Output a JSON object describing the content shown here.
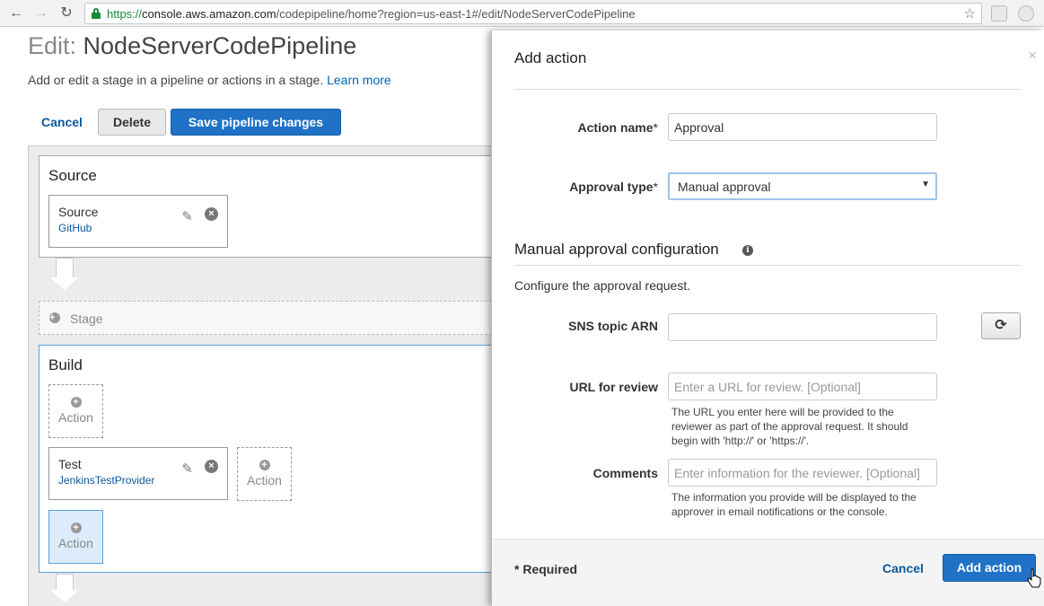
{
  "browser": {
    "url_proto": "https://",
    "url_host": "console.aws.amazon.com",
    "url_path": "/codepipeline/home?region=us-east-1#/edit/NodeServerCodePipeline"
  },
  "header": {
    "title_prefix": "Edit:",
    "title_name": "NodeServerCodePipeline",
    "description": "Add or edit a stage in a pipeline or actions in a stage.",
    "learn_more": "Learn more"
  },
  "toolbar": {
    "cancel_label": "Cancel",
    "delete_label": "Delete",
    "save_label": "Save pipeline changes"
  },
  "pipeline": {
    "source_stage": {
      "title": "Source",
      "action": {
        "name": "Source",
        "provider": "GitHub"
      }
    },
    "add_stage_label": "Stage",
    "build_stage": {
      "title": "Build",
      "add_action_label": "Action",
      "action": {
        "name": "Test",
        "provider": "JenkinsTestProvider"
      }
    }
  },
  "modal": {
    "title": "Add action",
    "action_name_label": "Action name",
    "action_name_value": "Approval",
    "approval_type_label": "Approval type",
    "approval_type_value": "Manual approval",
    "required_mark": "*",
    "section_title": "Manual approval configuration",
    "section_desc": "Configure the approval request.",
    "sns_label": "SNS topic ARN",
    "url_label": "URL for review",
    "url_placeholder": "Enter a URL for review. [Optional]",
    "url_help": "The URL you enter here will be provided to the reviewer as part of the approval request. It should begin with 'http://' or 'https://'.",
    "comments_label": "Comments",
    "comments_placeholder": "Enter information for the reviewer. [Optional]",
    "comments_help": "The information you provide will be displayed to the approver in email notifications or the console.",
    "footer_required": "* Required",
    "footer_cancel": "Cancel",
    "footer_add": "Add action"
  },
  "colors": {
    "primary_button": "#1f72c5",
    "link": "#0b5aa0",
    "secure_green": "#1a8a3a"
  }
}
